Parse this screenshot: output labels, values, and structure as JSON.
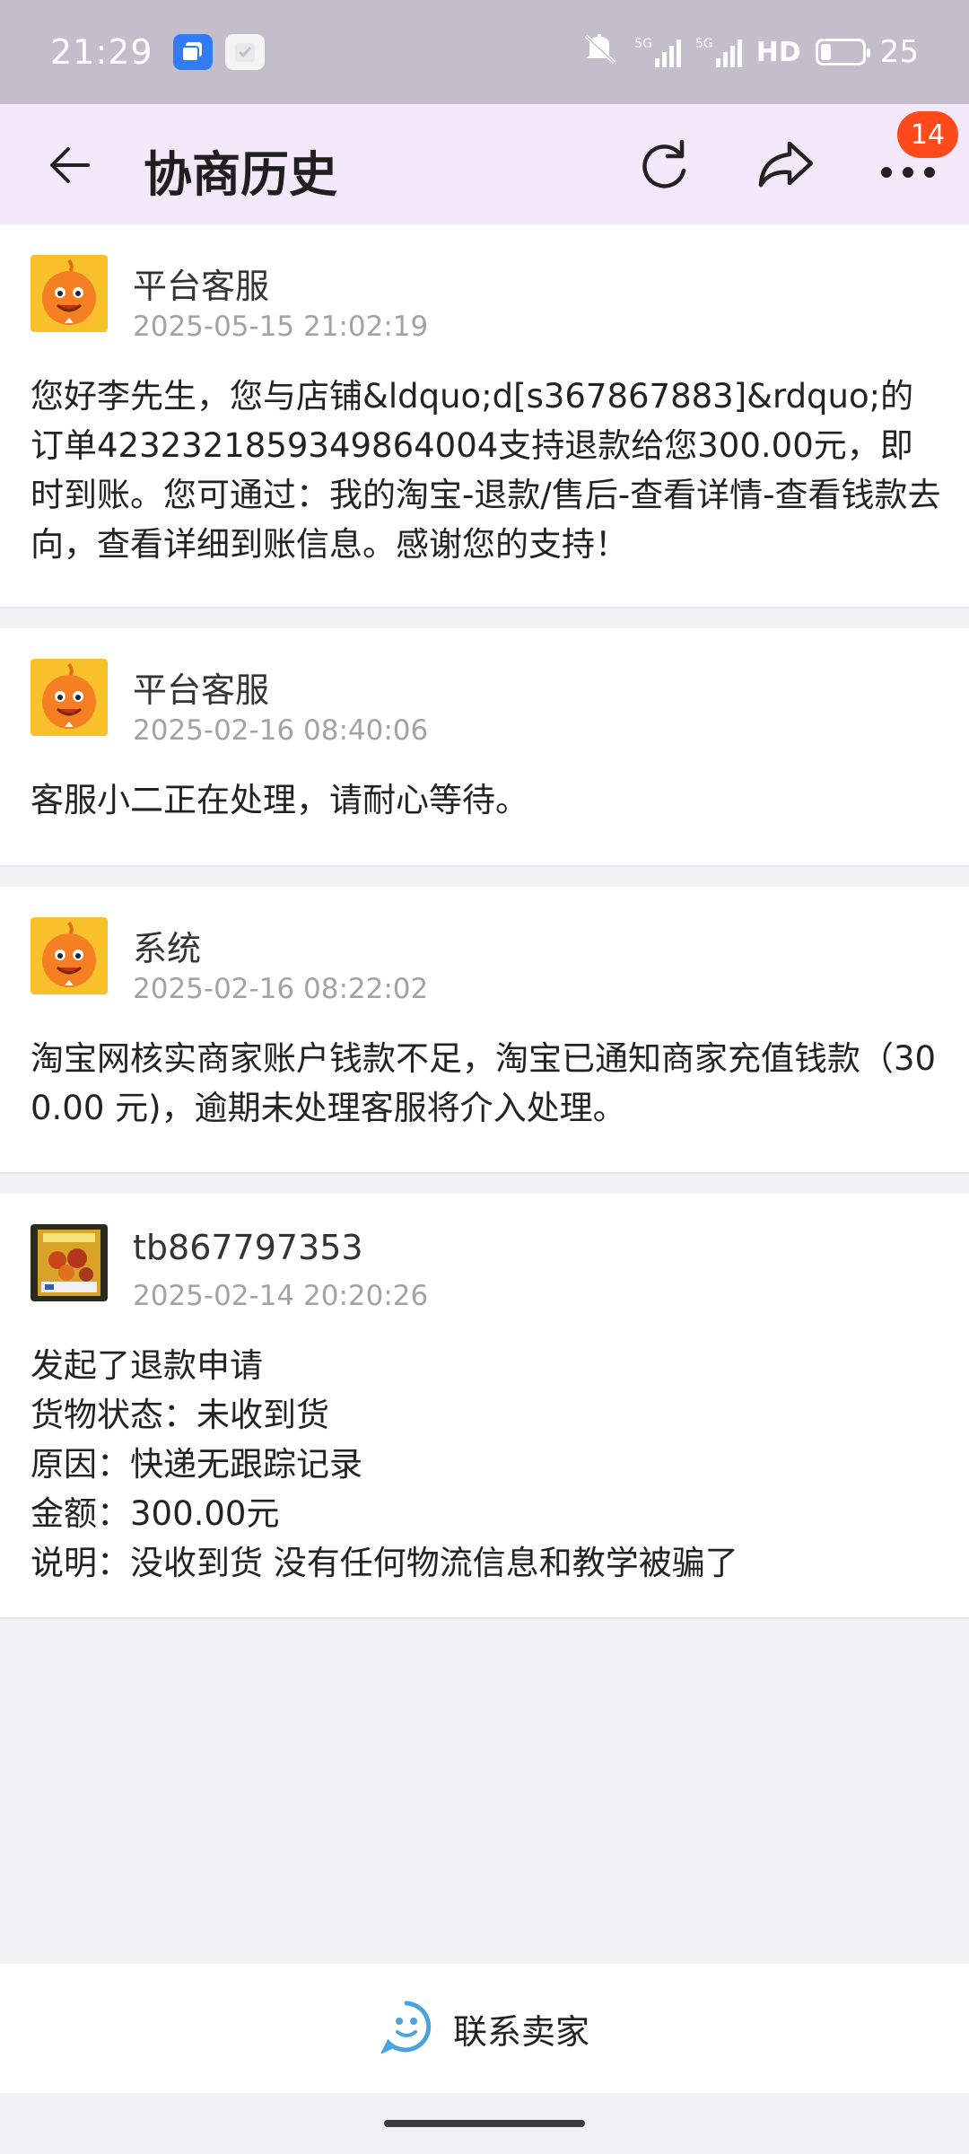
{
  "status_bar": {
    "time": "21:29",
    "network_1": "5G",
    "network_2": "5G",
    "hd_label": "HD",
    "battery": "25",
    "battery_level": 0.25
  },
  "header": {
    "title": "协商历史",
    "badge_count": "14",
    "icons": [
      "back-arrow-icon",
      "refresh-icon",
      "share-icon",
      "more-icon"
    ]
  },
  "records": [
    {
      "name": "平台客服",
      "time": "2025-05-15 21:02:19",
      "avatar": "orange-mascot-avatar",
      "lines": [
        "您好李先生，您与店铺&ldquo;d[s367867883]&rdquo;的订单4232321859349864004支持退款给您300.00元，即时到账。您可通过：我的淘宝-退款/售后-查看详情-查看钱款去向，查看详细到账信息。感谢您的支持！"
      ]
    },
    {
      "name": "平台客服",
      "time": "2025-02-16 08:40:06",
      "avatar": "orange-mascot-avatar",
      "lines": [
        "客服小二正在处理，请耐心等待。"
      ]
    },
    {
      "name": "系统",
      "time": "2025-02-16 08:22:02",
      "avatar": "orange-mascot-avatar",
      "lines": [
        "淘宝网核实商家账户钱款不足，淘宝已通知商家充值钱款（300.00 元)，逾期未处理客服将介入处理。"
      ]
    },
    {
      "name": "tb867797353",
      "time": "2025-02-14 20:20:26",
      "avatar": "user-photo-avatar",
      "lines": [
        "发起了退款申请",
        "货物状态：未收到货",
        "原因：快递无跟踪记录",
        "金额：300.00元",
        "说明：没收到货 没有任何物流信息和教学被骗了"
      ]
    }
  ],
  "bottom": {
    "contact_label": "联系卖家"
  },
  "colors": {
    "status_bar": "#c3bdcc",
    "header_bg": "#f3e9fb",
    "badge": "#ff4a1c",
    "mascot_orange": "#f57f22",
    "mascot_yellow": "#f8c12c",
    "contact_icon": "#4aa3df"
  }
}
